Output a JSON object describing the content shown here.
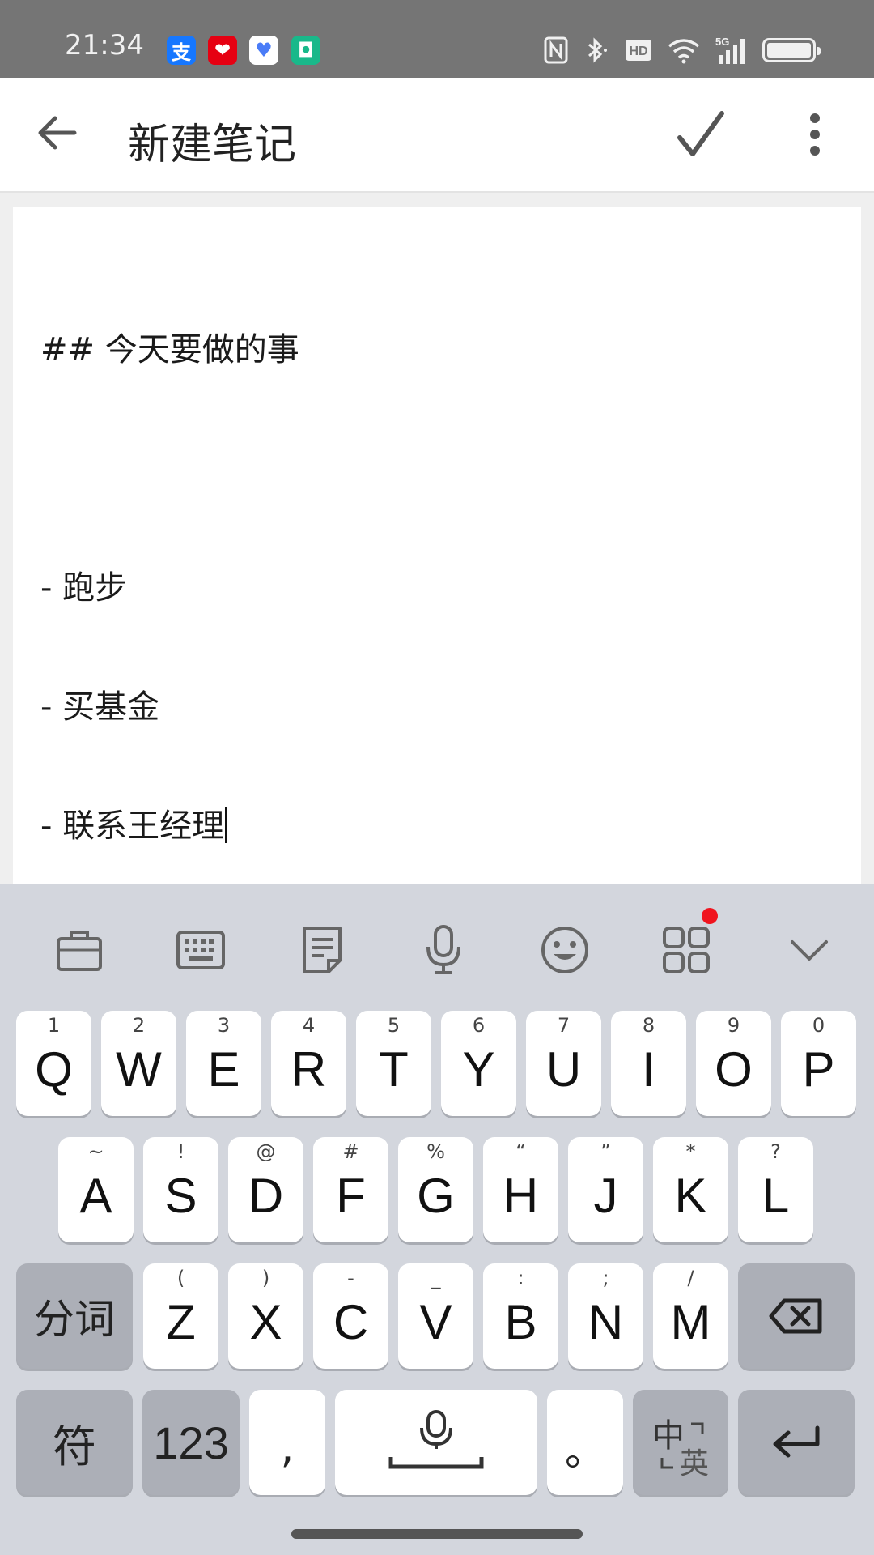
{
  "status_bar": {
    "time": "21:34",
    "app_icons": [
      {
        "name": "alipay-app-icon",
        "glyph": "支",
        "bg": "#1677ff",
        "fg": "#ffffff"
      },
      {
        "name": "heart-app-icon",
        "glyph": "❤",
        "bg": "#e60012",
        "fg": "#ffffff"
      },
      {
        "name": "health-app-icon",
        "glyph": "♥",
        "bg": "#ffffff",
        "fg": "#4a7cf7"
      },
      {
        "name": "mihome-app-icon",
        "glyph": "◘",
        "bg": "#19b88a",
        "fg": "#ffffff"
      }
    ],
    "hd_label": "HD",
    "network_label": "5G"
  },
  "app_bar": {
    "title": "新建笔记"
  },
  "editor": {
    "lines": [
      "## 今天要做的事",
      "",
      "- 跑步",
      "- 买基金",
      "- 联系王经理"
    ]
  },
  "keyboard": {
    "toolbar": [
      "briefcase-icon",
      "keyboard-icon",
      "clipboard-icon",
      "microphone-icon",
      "emoji-icon",
      "apps-grid-icon",
      "collapse-chevron-icon"
    ],
    "row1": [
      {
        "sub": "1",
        "main": "Q"
      },
      {
        "sub": "2",
        "main": "W"
      },
      {
        "sub": "3",
        "main": "E"
      },
      {
        "sub": "4",
        "main": "R"
      },
      {
        "sub": "5",
        "main": "T"
      },
      {
        "sub": "6",
        "main": "Y"
      },
      {
        "sub": "7",
        "main": "U"
      },
      {
        "sub": "8",
        "main": "I"
      },
      {
        "sub": "9",
        "main": "O"
      },
      {
        "sub": "0",
        "main": "P"
      }
    ],
    "row2": [
      {
        "sub": "~",
        "main": "A"
      },
      {
        "sub": "!",
        "main": "S"
      },
      {
        "sub": "@",
        "main": "D"
      },
      {
        "sub": "#",
        "main": "F"
      },
      {
        "sub": "%",
        "main": "G"
      },
      {
        "sub": "“",
        "main": "H"
      },
      {
        "sub": "”",
        "main": "J"
      },
      {
        "sub": "*",
        "main": "K"
      },
      {
        "sub": "?",
        "main": "L"
      }
    ],
    "row3": [
      {
        "sub": "(",
        "main": "Z"
      },
      {
        "sub": ")",
        "main": "X"
      },
      {
        "sub": "-",
        "main": "C"
      },
      {
        "sub": "_",
        "main": "V"
      },
      {
        "sub": ":",
        "main": "B"
      },
      {
        "sub": ";",
        "main": "N"
      },
      {
        "sub": "/",
        "main": "M"
      }
    ],
    "segment_label": "分词",
    "symbol_label": "符",
    "numeric_label": "123",
    "comma_label": ",",
    "period_label": "。",
    "lang_switch": {
      "primary": "中",
      "secondary": "英"
    }
  }
}
